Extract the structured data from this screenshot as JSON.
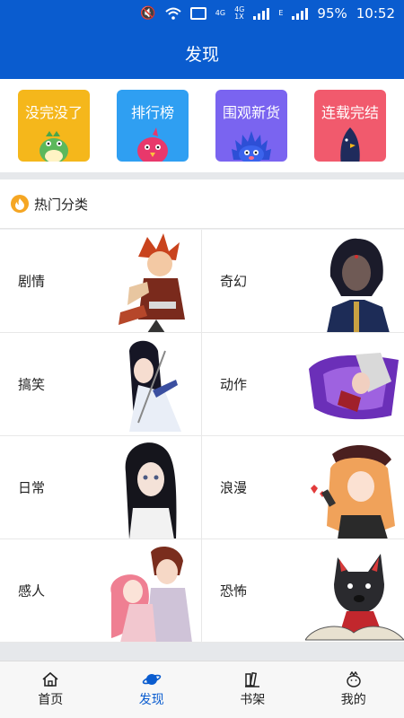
{
  "status": {
    "battery": "95%",
    "time": "10:52",
    "network_a": "4G",
    "network_b": "4G",
    "network_c": "1X",
    "signal_letter": "E"
  },
  "header": {
    "title": "发现"
  },
  "tiles": [
    {
      "label": "没完没了",
      "color": "#f5b71b",
      "icon": "green-dinosaur-mascot"
    },
    {
      "label": "排行榜",
      "color": "#2f9ff2",
      "icon": "pink-bird-mascot"
    },
    {
      "label": "围观新货",
      "color": "#7a64f0",
      "icon": "blue-hedgehog-mascot"
    },
    {
      "label": "连载完结",
      "color": "#f15a6d",
      "icon": "dark-bird-mascot"
    }
  ],
  "section": {
    "title": "热门分类",
    "icon": "fire-icon"
  },
  "categories": [
    {
      "label": "剧情",
      "art": "red-haired-warrior"
    },
    {
      "label": "奇幻",
      "art": "dark-haired-girl"
    },
    {
      "label": "搞笑",
      "art": "long-haired-swordsman"
    },
    {
      "label": "动作",
      "art": "purple-cape-fighter"
    },
    {
      "label": "日常",
      "art": "black-haired-girl"
    },
    {
      "label": "浪漫",
      "art": "blonde-girl-with-cap"
    },
    {
      "label": "感人",
      "art": "couple"
    },
    {
      "label": "恐怖",
      "art": "black-wolf"
    }
  ],
  "nav": [
    {
      "label": "首页",
      "icon": "home-icon",
      "active": false
    },
    {
      "label": "发现",
      "icon": "planet-icon",
      "active": true
    },
    {
      "label": "书架",
      "icon": "bookshelf-icon",
      "active": false
    },
    {
      "label": "我的",
      "icon": "profile-icon",
      "active": false
    }
  ]
}
